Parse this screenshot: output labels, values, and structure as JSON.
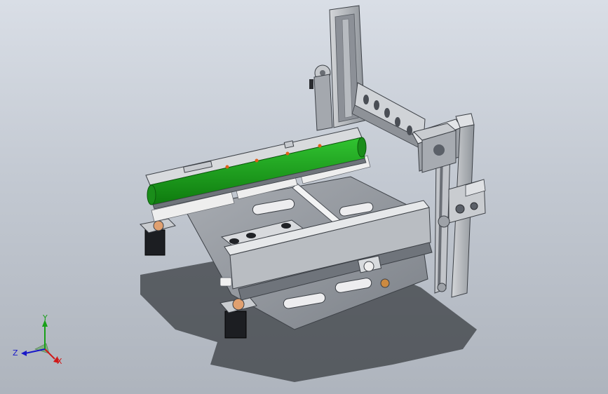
{
  "view": {
    "background_top": "#d9dee6",
    "background_bottom": "#aeb4bd"
  },
  "model": {
    "frame_color": "#c9ccd0",
    "frame_dark": "#5b6068",
    "belt_color": "#1fa81f",
    "motor_color": "#202226",
    "rack_color": "#e8e8e8"
  },
  "triad": {
    "x_label": "X",
    "y_label": "Y",
    "z_label": "Z",
    "x_color": "#d01818",
    "y_color": "#18a018",
    "z_color": "#1818c8"
  }
}
